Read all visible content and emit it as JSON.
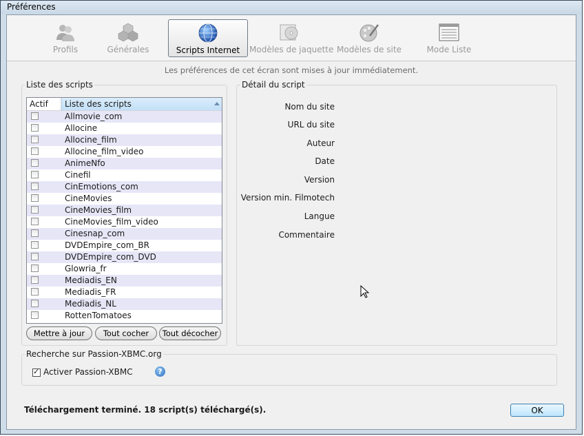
{
  "window": {
    "title": "Préférences"
  },
  "toolbar": {
    "items": [
      {
        "label": "Profils",
        "icon": "users-icon",
        "active": false
      },
      {
        "label": "Générales",
        "icon": "cubes-icon",
        "active": false
      },
      {
        "label": "Scripts Internet",
        "icon": "globe-icon",
        "active": true
      },
      {
        "label": "Modèles de jaquette",
        "icon": "disc-case-icon",
        "active": false
      },
      {
        "label": "Modèles de site",
        "icon": "palette-icon",
        "active": false
      },
      {
        "label": "Mode Liste",
        "icon": "list-window-icon",
        "active": false
      }
    ]
  },
  "info_text": "Les préférences de cet écran sont mises à jour immédiatement.",
  "scripts": {
    "group_title": "Liste des scripts",
    "col_active": "Actif",
    "col_name": "Liste des scripts",
    "items": [
      {
        "name": "Allmovie_com",
        "checked": false
      },
      {
        "name": "Allocine",
        "checked": false
      },
      {
        "name": "Allocine_film",
        "checked": false
      },
      {
        "name": "Allocine_film_video",
        "checked": false
      },
      {
        "name": "AnimeNfo",
        "checked": false
      },
      {
        "name": "Cinefil",
        "checked": false
      },
      {
        "name": "CinEmotions_com",
        "checked": false
      },
      {
        "name": "CineMovies",
        "checked": false
      },
      {
        "name": "CineMovies_film",
        "checked": false
      },
      {
        "name": "CineMovies_film_video",
        "checked": false
      },
      {
        "name": "Cinesnap_com",
        "checked": false
      },
      {
        "name": "DVDEmpire_com_BR",
        "checked": false
      },
      {
        "name": "DVDEmpire_com_DVD",
        "checked": false
      },
      {
        "name": "Glowria_fr",
        "checked": false
      },
      {
        "name": "Mediadis_EN",
        "checked": false
      },
      {
        "name": "Mediadis_FR",
        "checked": false
      },
      {
        "name": "Mediadis_NL",
        "checked": false
      },
      {
        "name": "RottenTomatoes",
        "checked": false
      }
    ],
    "btn_update": "Mettre à jour",
    "btn_check_all": "Tout cocher",
    "btn_uncheck_all": "Tout décocher"
  },
  "detail": {
    "group_title": "Détail du script",
    "fields": [
      "Nom du site",
      "URL du site",
      "Auteur",
      "Date",
      "Version",
      "Version min. Filmotech",
      "Langue",
      "Commentaire"
    ]
  },
  "passion": {
    "group_title": "Recherche sur Passion-XBMC.org",
    "checkbox_label": "Activer Passion-XBMC",
    "checked": true,
    "help_symbol": "?"
  },
  "status_text": "Téléchargement terminé. 18 script(s) téléchargé(s).",
  "ok_label": "OK"
}
